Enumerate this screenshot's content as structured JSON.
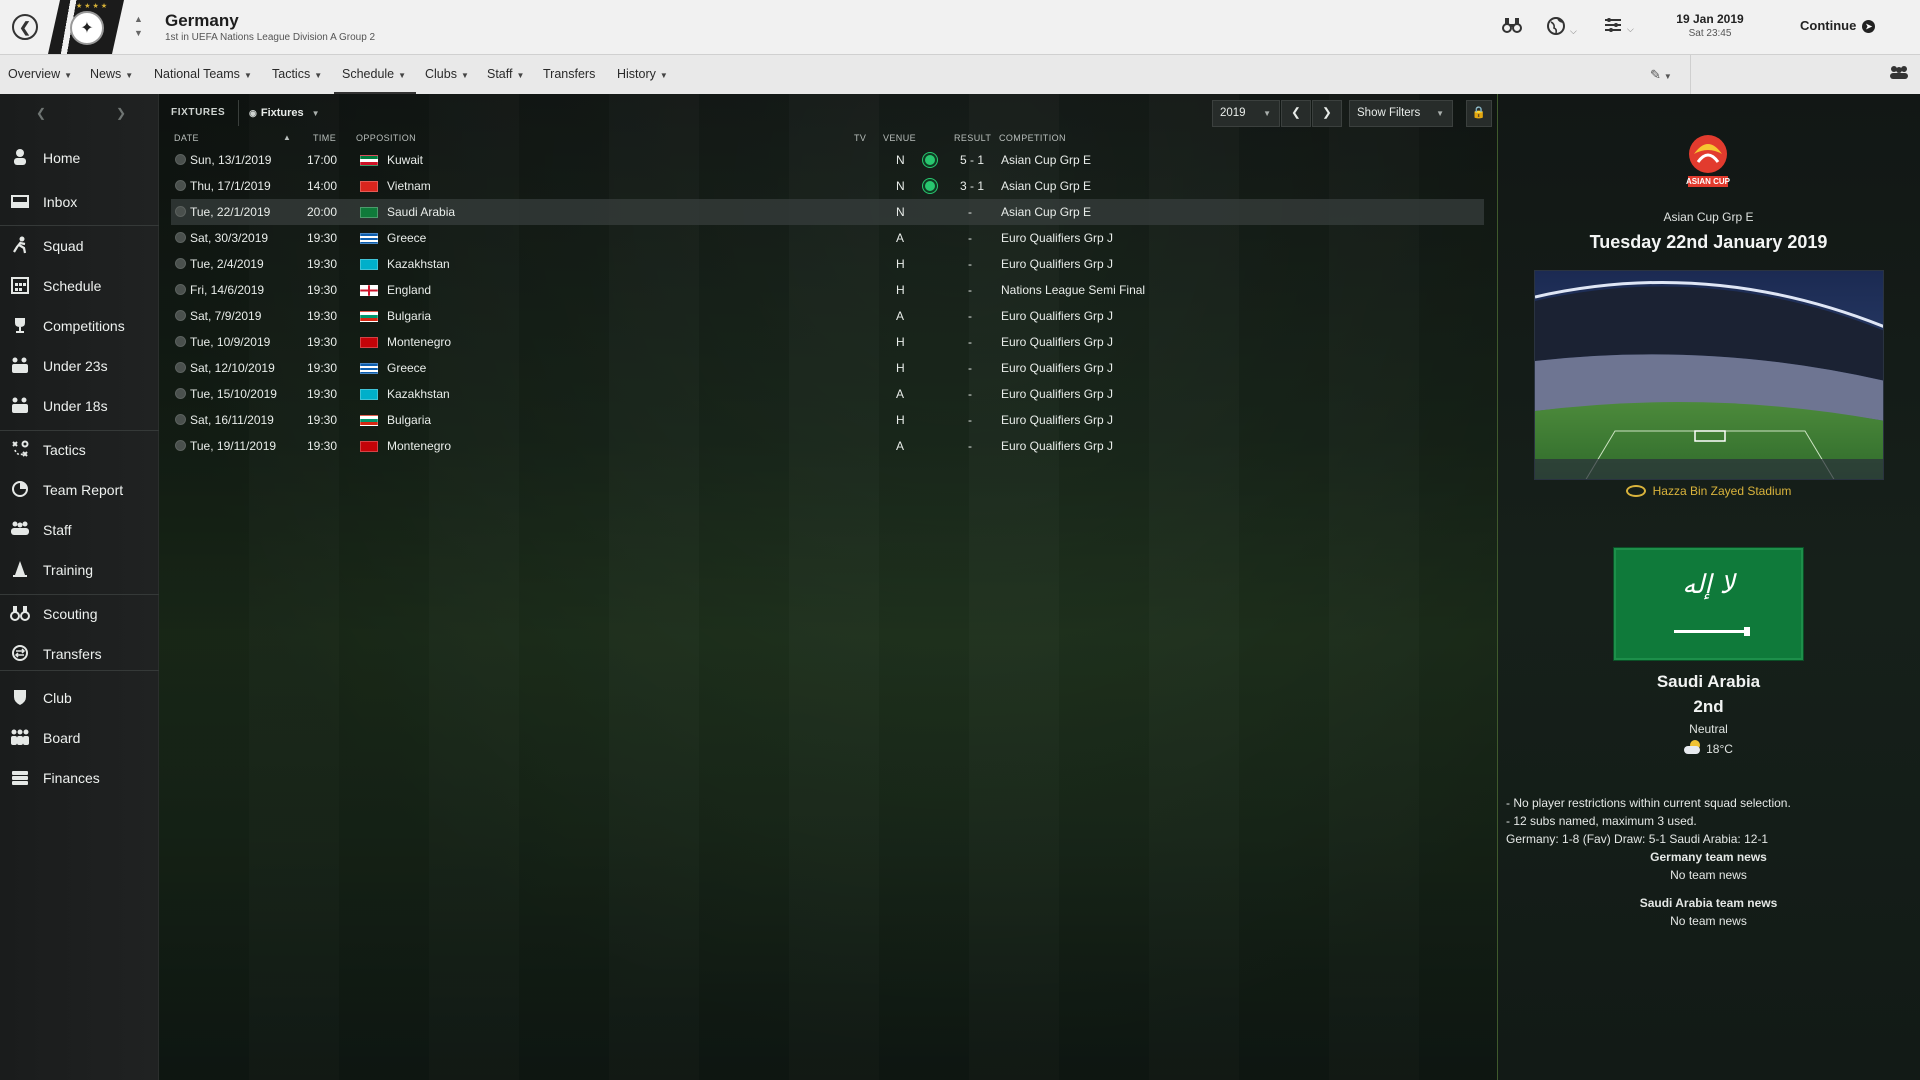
{
  "header": {
    "team_name": "Germany",
    "team_subtitle": "1st in UEFA Nations League Division A Group 2",
    "date": "19 Jan 2019",
    "time": "Sat 23:45",
    "continue_label": "Continue"
  },
  "nav": {
    "items": [
      {
        "label": "Overview",
        "dropdown": true
      },
      {
        "label": "News",
        "dropdown": true
      },
      {
        "label": "National Teams",
        "dropdown": true
      },
      {
        "label": "Tactics",
        "dropdown": true
      },
      {
        "label": "Schedule",
        "dropdown": true,
        "active": true
      },
      {
        "label": "Clubs",
        "dropdown": true
      },
      {
        "label": "Staff",
        "dropdown": true
      },
      {
        "label": "Transfers",
        "dropdown": false
      },
      {
        "label": "History",
        "dropdown": true
      }
    ]
  },
  "sidebar": {
    "items": [
      {
        "label": "Home",
        "icon": "home-icon"
      },
      {
        "label": "Inbox",
        "icon": "inbox-icon"
      },
      {
        "label": "Squad",
        "icon": "squad-icon"
      },
      {
        "label": "Schedule",
        "icon": "calendar-icon"
      },
      {
        "label": "Competitions",
        "icon": "trophy-icon"
      },
      {
        "label": "Under 23s",
        "icon": "under23-icon"
      },
      {
        "label": "Under 18s",
        "icon": "under18-icon"
      },
      {
        "label": "Tactics",
        "icon": "tactics-icon"
      },
      {
        "label": "Team Report",
        "icon": "report-icon"
      },
      {
        "label": "Staff",
        "icon": "staff-icon"
      },
      {
        "label": "Training",
        "icon": "cone-icon"
      },
      {
        "label": "Scouting",
        "icon": "binoculars-icon"
      },
      {
        "label": "Transfers",
        "icon": "transfers-icon"
      },
      {
        "label": "Club",
        "icon": "shield-icon"
      },
      {
        "label": "Board",
        "icon": "board-icon"
      },
      {
        "label": "Finances",
        "icon": "money-icon"
      }
    ]
  },
  "toolbar": {
    "section_label": "FIXTURES",
    "view_label": "Fixtures",
    "year": "2019",
    "filters_label": "Show Filters"
  },
  "table": {
    "headers": {
      "date": "DATE",
      "time": "TIME",
      "opposition": "OPPOSITION",
      "tv": "TV",
      "venue": "VENUE",
      "result": "RESULT",
      "competition": "COMPETITION"
    },
    "rows": [
      {
        "date": "Sun, 13/1/2019",
        "time": "17:00",
        "opp": "Kuwait",
        "flag": "kuwait",
        "venue": "N",
        "win": true,
        "result": "5 - 1",
        "comp": "Asian Cup Grp E"
      },
      {
        "date": "Thu, 17/1/2019",
        "time": "14:00",
        "opp": "Vietnam",
        "flag": "vietnam",
        "venue": "N",
        "win": true,
        "result": "3 - 1",
        "comp": "Asian Cup Grp E"
      },
      {
        "date": "Tue, 22/1/2019",
        "time": "20:00",
        "opp": "Saudi Arabia",
        "flag": "saudi",
        "venue": "N",
        "win": false,
        "result": "-",
        "comp": "Asian Cup Grp E",
        "selected": true
      },
      {
        "date": "Sat, 30/3/2019",
        "time": "19:30",
        "opp": "Greece",
        "flag": "greece",
        "venue": "A",
        "win": false,
        "result": "-",
        "comp": "Euro Qualifiers Grp J"
      },
      {
        "date": "Tue, 2/4/2019",
        "time": "19:30",
        "opp": "Kazakhstan",
        "flag": "kazakhstan",
        "venue": "H",
        "win": false,
        "result": "-",
        "comp": "Euro Qualifiers Grp J"
      },
      {
        "date": "Fri, 14/6/2019",
        "time": "19:30",
        "opp": "England",
        "flag": "england",
        "venue": "H",
        "win": false,
        "result": "-",
        "comp": "Nations League Semi Final"
      },
      {
        "date": "Sat, 7/9/2019",
        "time": "19:30",
        "opp": "Bulgaria",
        "flag": "bulgaria",
        "venue": "A",
        "win": false,
        "result": "-",
        "comp": "Euro Qualifiers Grp J"
      },
      {
        "date": "Tue, 10/9/2019",
        "time": "19:30",
        "opp": "Montenegro",
        "flag": "montenegro",
        "venue": "H",
        "win": false,
        "result": "-",
        "comp": "Euro Qualifiers Grp J"
      },
      {
        "date": "Sat, 12/10/2019",
        "time": "19:30",
        "opp": "Greece",
        "flag": "greece",
        "venue": "H",
        "win": false,
        "result": "-",
        "comp": "Euro Qualifiers Grp J"
      },
      {
        "date": "Tue, 15/10/2019",
        "time": "19:30",
        "opp": "Kazakhstan",
        "flag": "kazakhstan",
        "venue": "A",
        "win": false,
        "result": "-",
        "comp": "Euro Qualifiers Grp J"
      },
      {
        "date": "Sat, 16/11/2019",
        "time": "19:30",
        "opp": "Bulgaria",
        "flag": "bulgaria",
        "venue": "H",
        "win": false,
        "result": "-",
        "comp": "Euro Qualifiers Grp J"
      },
      {
        "date": "Tue, 19/11/2019",
        "time": "19:30",
        "opp": "Montenegro",
        "flag": "montenegro",
        "venue": "A",
        "win": false,
        "result": "-",
        "comp": "Euro Qualifiers Grp J"
      }
    ]
  },
  "panel": {
    "logo_text": "ASIAN CUP",
    "competition": "Asian Cup Grp E",
    "match_date": "Tuesday 22nd January 2019",
    "stadium": "Hazza Bin Zayed Stadium",
    "opponent": "Saudi Arabia",
    "opponent_position": "2nd",
    "venue": "Neutral",
    "temperature": "18°C",
    "note1": "- No player restrictions within current squad selection.",
    "note2": "- 12 subs named, maximum 3 used.",
    "odds": "Germany: 1-8 (Fav) Draw: 5-1 Saudi Arabia: 12-1",
    "home_news_title": "Germany team news",
    "home_news": "No team news",
    "away_news_title": "Saudi Arabia team news",
    "away_news": "No team news"
  },
  "colors": {
    "win_dot": "#28c76f",
    "stadium_link": "#d9b33c",
    "saudi_green": "#0f7a3a"
  }
}
